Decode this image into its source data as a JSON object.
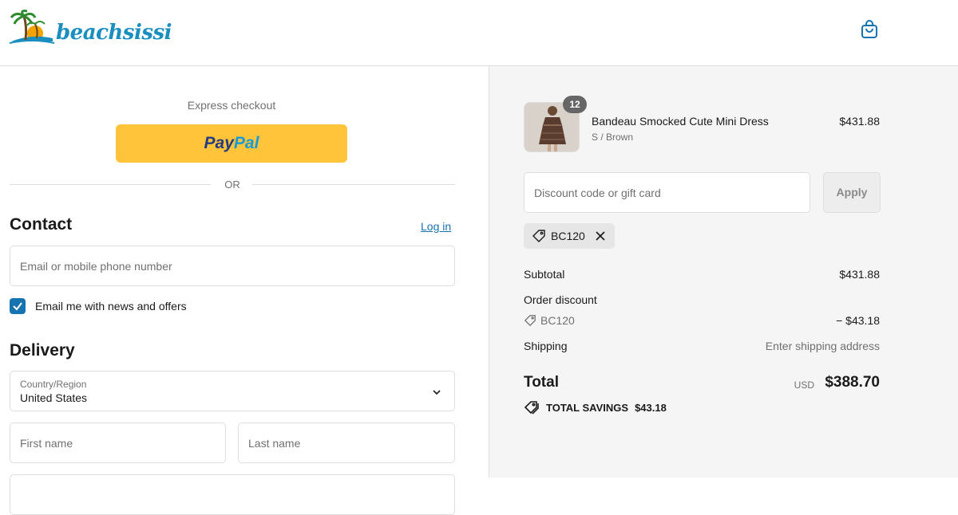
{
  "header": {
    "brand_name": "beachsissi",
    "cart_icon": "shopping-bag-icon"
  },
  "checkout": {
    "express_label": "Express checkout",
    "paypal": {
      "part1": "Pay",
      "part2": "Pal"
    },
    "or_label": "OR",
    "contact": {
      "title": "Contact",
      "login_label": "Log in",
      "email_placeholder": "Email or mobile phone number",
      "newsletter_label": "Email me with news and offers",
      "newsletter_checked": true
    },
    "delivery": {
      "title": "Delivery",
      "country_label": "Country/Region",
      "country_value": "United States",
      "first_name_placeholder": "First name",
      "last_name_placeholder": "Last name"
    }
  },
  "summary": {
    "item": {
      "quantity": "12",
      "name": "Bandeau Smocked Cute Mini Dress",
      "variant": "S / Brown",
      "price": "$431.88"
    },
    "discount_placeholder": "Discount code or gift card",
    "apply_label": "Apply",
    "applied_code": "BC120",
    "subtotal_label": "Subtotal",
    "subtotal_value": "$431.88",
    "order_discount_label": "Order discount",
    "discount_code": "BC120",
    "discount_value": "− $43.18",
    "shipping_label": "Shipping",
    "shipping_value": "Enter shipping address",
    "total_label": "Total",
    "total_currency": "USD",
    "total_value": "$388.70",
    "savings_label": "TOTAL SAVINGS",
    "savings_value": "$43.18"
  },
  "colors": {
    "accent": "#1773b0",
    "paypal_yellow": "#ffc439",
    "panel_bg": "#f5f5f5"
  }
}
